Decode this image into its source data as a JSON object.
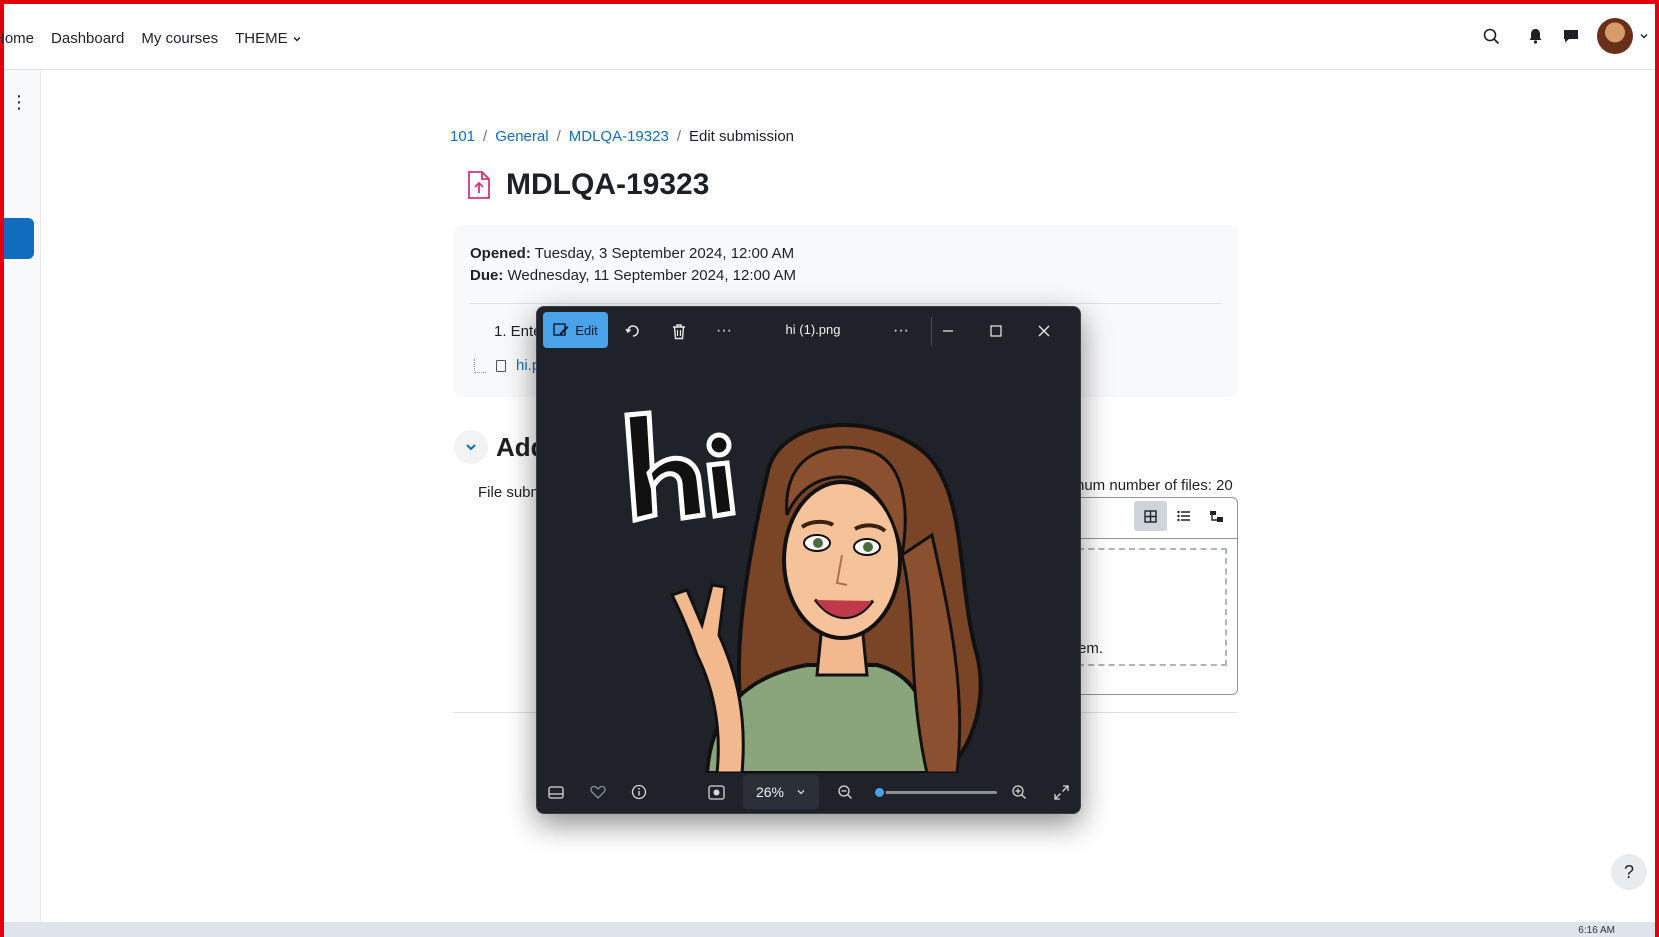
{
  "nav": {
    "links": [
      "Home",
      "Dashboard",
      "My courses",
      "THEME"
    ]
  },
  "breadcrumb": [
    "101",
    "General",
    "MDLQA-19323",
    "Edit submission"
  ],
  "page": {
    "title": "MDLQA-19323",
    "opened_label": "Opened:",
    "opened_value": "Tuesday, 3 September 2024, 12:00 AM",
    "due_label": "Due:",
    "due_value": "Wednesday, 11 September 2024, 12:00 AM",
    "instruction_partial": "1. Ente",
    "file_link_partial": "hi.p",
    "section_title_partial": "Add",
    "file_submission_partial": "File subm",
    "max_files_partial": "num number of files: 20",
    "drop_text_partial": "em."
  },
  "viewer": {
    "edit_label": "Edit",
    "filename": "hi (1).png",
    "zoom": "26%",
    "zoom_fraction": 0.0
  },
  "colors": {
    "link": "#0f6cbf",
    "accent_blue": "#4aa3e8",
    "viewer_bg": "#1f2329",
    "frame_red": "#e2000f"
  },
  "icons": [
    "search-icon",
    "bell-icon",
    "chat-icon",
    "kebab-icon",
    "upload-file-icon",
    "chevron-down-icon",
    "grid-view-icon",
    "list-view-icon",
    "tree-view-icon",
    "help-icon"
  ],
  "taskbar": {
    "time": "6:16 AM"
  }
}
